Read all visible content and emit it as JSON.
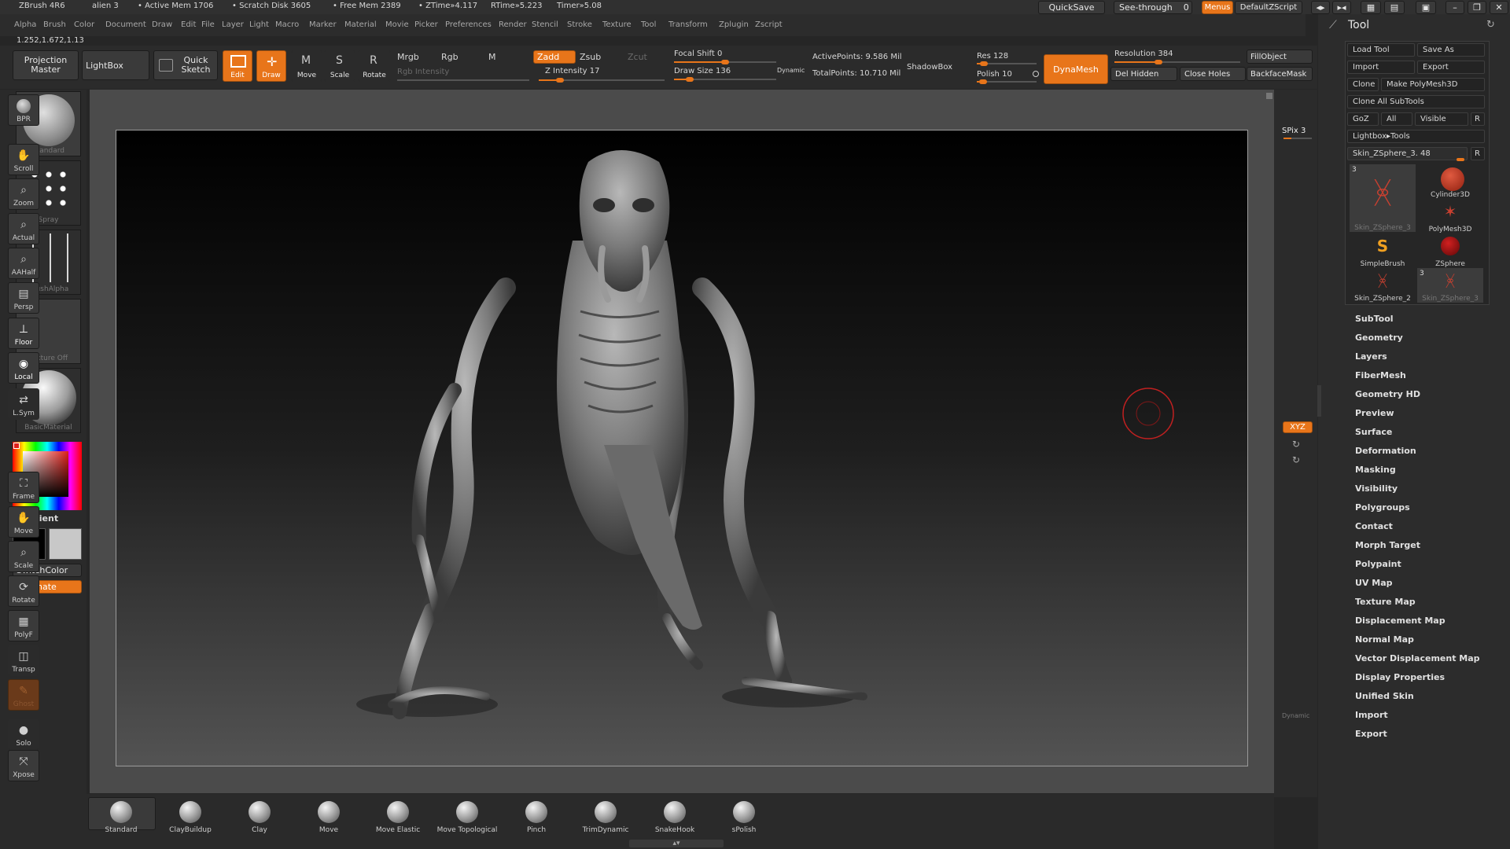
{
  "titlebar": {
    "app": "ZBrush 4R6",
    "document": "alien 3",
    "active_mem": "• Active Mem 1706",
    "scratch": "• Scratch Disk 3605",
    "free_mem": "• Free Mem 2389",
    "ztime": "• ZTime»4.117",
    "rtime": "RTime»5.223",
    "timer": "Timer»5.08",
    "quicksave": "QuickSave",
    "see_through": "See-through",
    "see_through_value": "0",
    "menus": "Menus",
    "zscript": "DefaultZScript"
  },
  "menubar": [
    "Alpha",
    "Brush",
    "Color",
    "Document",
    "Draw",
    "Edit",
    "File",
    "Layer",
    "Light",
    "Macro",
    "Marker",
    "Material",
    "Movie",
    "Picker",
    "Preferences",
    "Render",
    "Stencil",
    "Stroke",
    "Texture",
    "Tool",
    "Transform",
    "Zplugin",
    "Zscript"
  ],
  "coords": "1.252,1.672,1.13",
  "shelf": {
    "projection_master": "Projection Master",
    "lightbox": "LightBox",
    "quick_sketch": "Quick Sketch",
    "edit": "Edit",
    "draw": "Draw",
    "move": "Move",
    "scale": "Scale",
    "rotate": "Rotate",
    "mrgb": "Mrgb",
    "rgb": "Rgb",
    "m": "M",
    "rgb_intensity": "Rgb Intensity",
    "zadd": "Zadd",
    "zsub": "Zsub",
    "zcut": "Zcut",
    "z_intensity": "Z Intensity 17",
    "focal_shift": "Focal Shift 0",
    "draw_size": "Draw Size 136",
    "dynamic": "Dynamic",
    "active_points": "ActivePoints: 9.586 Mil",
    "total_points": "TotalPoints: 10.710 Mil",
    "shadowbox": "ShadowBox",
    "res": "Res 128",
    "polish": "Polish 10",
    "dynamesh": "DynaMesh",
    "resolution": "Resolution 384",
    "del_hidden": "Del Hidden",
    "close_holes": "Close Holes",
    "fill_object": "FillObject",
    "backface_mask": "BackfaceMask",
    "z_intensity_level": 0.17,
    "focal_shift_level": 0.5,
    "draw_size_level": 0.15,
    "res_level": 0.12,
    "polish_level": 0.1,
    "resolution_level": 0.35
  },
  "left": {
    "brush": "Standard",
    "stroke": "Spray",
    "alpha": "BrushAlpha",
    "texture": "Texture Off",
    "material": "BasicMaterial",
    "gradient": "Gradient",
    "switch_color": "SwitchColor",
    "alternate": "Alternate"
  },
  "right": {
    "bpr": "BPR",
    "spix": "SPix 3",
    "scroll": "Scroll",
    "zoom": "Zoom",
    "actual": "Actual",
    "aahalf": "AAHalf",
    "persp": "Persp",
    "floor": "Floor",
    "local": "Local",
    "lsym": "L.Sym",
    "xyz": "XYZ",
    "frame": "Frame",
    "move": "Move",
    "scale": "Scale",
    "rotate": "Rotate",
    "polyf": "PolyF",
    "transp": "Transp",
    "ghost": "Ghost",
    "dynamic": "Dynamic",
    "solo": "Solo",
    "xpose": "Xpose"
  },
  "bottom_brushes": [
    "Standard",
    "ClayBuildup",
    "Clay",
    "Move",
    "Move Elastic",
    "Move Topological",
    "Pinch",
    "TrimDynamic",
    "SnakeHook",
    "sPolish"
  ],
  "tool": {
    "title": "Tool",
    "load_tool": "Load Tool",
    "save_as": "Save As",
    "import": "Import",
    "export": "Export",
    "clone": "Clone",
    "make_polymesh": "Make PolyMesh3D",
    "clone_all": "Clone All SubTools",
    "goz": "GoZ",
    "all": "All",
    "visible": "Visible",
    "r": "R",
    "lightbox_tools": "Lightbox▸Tools",
    "current_tool": "Skin_ZSphere_3. 48",
    "thumbs": [
      {
        "label": "Skin_ZSphere_3",
        "count": "3"
      },
      {
        "label": "Cylinder3D",
        "count": ""
      },
      {
        "label": "PolyMesh3D",
        "count": ""
      },
      {
        "label": "SimpleBrush",
        "count": ""
      },
      {
        "label": "ZSphere",
        "count": ""
      },
      {
        "label": "Skin_ZSphere_2",
        "count": ""
      },
      {
        "label": "Skin_ZSphere_3",
        "count": "3"
      }
    ],
    "sections": [
      "SubTool",
      "Geometry",
      "Layers",
      "FiberMesh",
      "Geometry HD",
      "Preview",
      "Surface",
      "Deformation",
      "Masking",
      "Visibility",
      "Polygroups",
      "Contact",
      "Morph Target",
      "Polypaint",
      "UV Map",
      "Texture Map",
      "Displacement Map",
      "Normal Map",
      "Vector Displacement Map",
      "Display Properties",
      "Unified Skin",
      "Import",
      "Export"
    ]
  },
  "colors": {
    "accent": "#e8751a",
    "bg": "#262626",
    "panel": "#2c2c2c"
  }
}
